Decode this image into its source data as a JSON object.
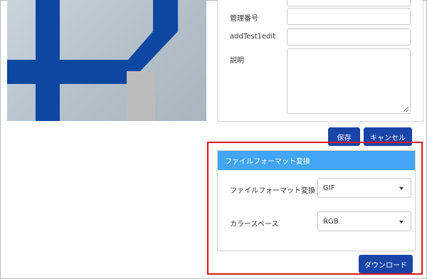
{
  "form": {
    "management_number_label": "管理番号",
    "add_test_label": "addTest1edit",
    "description_label": "説明"
  },
  "buttons": {
    "save": "保存",
    "cancel": "キャンセル",
    "download": "ダウンロード"
  },
  "convert_panel": {
    "title": "ファイルフォーマット変換",
    "file_format_label": "ファイルフォーマット変換",
    "file_format_value": "GIF",
    "color_space_label": "カラースペース",
    "color_space_value": "RGB"
  },
  "colors": {
    "primary_button": "#1a45a8",
    "panel_header": "#42a5f5",
    "highlight": "#e0141e"
  }
}
